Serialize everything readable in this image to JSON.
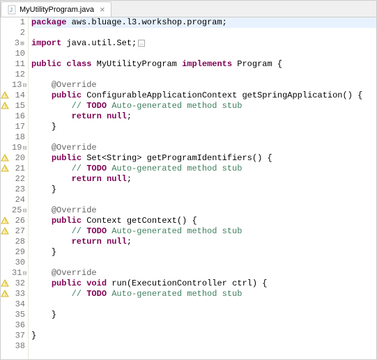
{
  "tab": {
    "filename": "MyUtilityProgram.java",
    "close": "×"
  },
  "lines": [
    {
      "num": "1",
      "marker": "",
      "fold": "",
      "highlighted": true,
      "segs": [
        {
          "t": "kw",
          "v": "package"
        },
        {
          "t": "",
          "v": " aws.bluage.l3.workshop.program;"
        }
      ],
      "cursor": true
    },
    {
      "num": "2",
      "marker": "",
      "fold": "",
      "segs": []
    },
    {
      "num": "3",
      "marker": "",
      "fold": "⊕",
      "segs": [
        {
          "t": "kw",
          "v": "import"
        },
        {
          "t": "",
          "v": " java.util.Set;"
        }
      ],
      "collapsed": true
    },
    {
      "num": "10",
      "marker": "",
      "fold": "",
      "segs": []
    },
    {
      "num": "11",
      "marker": "",
      "fold": "",
      "segs": [
        {
          "t": "kw",
          "v": "public"
        },
        {
          "t": "",
          "v": " "
        },
        {
          "t": "kw",
          "v": "class"
        },
        {
          "t": "",
          "v": " MyUtilityProgram "
        },
        {
          "t": "kw",
          "v": "implements"
        },
        {
          "t": "",
          "v": " Program {"
        }
      ]
    },
    {
      "num": "12",
      "marker": "",
      "fold": "",
      "segs": []
    },
    {
      "num": "13",
      "marker": "",
      "fold": "⊖",
      "segs": [
        {
          "t": "",
          "v": "    "
        },
        {
          "t": "ann",
          "v": "@Override"
        }
      ]
    },
    {
      "num": "14",
      "marker": "warn",
      "fold": "",
      "segs": [
        {
          "t": "",
          "v": "    "
        },
        {
          "t": "kw",
          "v": "public"
        },
        {
          "t": "",
          "v": " ConfigurableApplicationContext getSpringApplication() {"
        }
      ]
    },
    {
      "num": "15",
      "marker": "warn",
      "fold": "",
      "segs": [
        {
          "t": "",
          "v": "        "
        },
        {
          "t": "comment",
          "v": "// "
        },
        {
          "t": "kw",
          "v": "TODO"
        },
        {
          "t": "comment",
          "v": " Auto-generated method stub"
        }
      ]
    },
    {
      "num": "16",
      "marker": "",
      "fold": "",
      "segs": [
        {
          "t": "",
          "v": "        "
        },
        {
          "t": "kw",
          "v": "return"
        },
        {
          "t": "",
          "v": " "
        },
        {
          "t": "kw",
          "v": "null"
        },
        {
          "t": "",
          "v": ";"
        }
      ]
    },
    {
      "num": "17",
      "marker": "",
      "fold": "",
      "segs": [
        {
          "t": "",
          "v": "    }"
        }
      ]
    },
    {
      "num": "18",
      "marker": "",
      "fold": "",
      "segs": []
    },
    {
      "num": "19",
      "marker": "",
      "fold": "⊖",
      "segs": [
        {
          "t": "",
          "v": "    "
        },
        {
          "t": "ann",
          "v": "@Override"
        }
      ]
    },
    {
      "num": "20",
      "marker": "warn",
      "fold": "",
      "segs": [
        {
          "t": "",
          "v": "    "
        },
        {
          "t": "kw",
          "v": "public"
        },
        {
          "t": "",
          "v": " Set<String> getProgramIdentifiers() {"
        }
      ]
    },
    {
      "num": "21",
      "marker": "warn",
      "fold": "",
      "segs": [
        {
          "t": "",
          "v": "        "
        },
        {
          "t": "comment",
          "v": "// "
        },
        {
          "t": "kw",
          "v": "TODO"
        },
        {
          "t": "comment",
          "v": " Auto-generated method stub"
        }
      ]
    },
    {
      "num": "22",
      "marker": "",
      "fold": "",
      "segs": [
        {
          "t": "",
          "v": "        "
        },
        {
          "t": "kw",
          "v": "return"
        },
        {
          "t": "",
          "v": " "
        },
        {
          "t": "kw",
          "v": "null"
        },
        {
          "t": "",
          "v": ";"
        }
      ]
    },
    {
      "num": "23",
      "marker": "",
      "fold": "",
      "segs": [
        {
          "t": "",
          "v": "    }"
        }
      ]
    },
    {
      "num": "24",
      "marker": "",
      "fold": "",
      "segs": []
    },
    {
      "num": "25",
      "marker": "",
      "fold": "⊖",
      "segs": [
        {
          "t": "",
          "v": "    "
        },
        {
          "t": "ann",
          "v": "@Override"
        }
      ]
    },
    {
      "num": "26",
      "marker": "warn",
      "fold": "",
      "segs": [
        {
          "t": "",
          "v": "    "
        },
        {
          "t": "kw",
          "v": "public"
        },
        {
          "t": "",
          "v": " Context getContext() {"
        }
      ]
    },
    {
      "num": "27",
      "marker": "warn",
      "fold": "",
      "segs": [
        {
          "t": "",
          "v": "        "
        },
        {
          "t": "comment",
          "v": "// "
        },
        {
          "t": "kw",
          "v": "TODO"
        },
        {
          "t": "comment",
          "v": " Auto-generated method stub"
        }
      ]
    },
    {
      "num": "28",
      "marker": "",
      "fold": "",
      "segs": [
        {
          "t": "",
          "v": "        "
        },
        {
          "t": "kw",
          "v": "return"
        },
        {
          "t": "",
          "v": " "
        },
        {
          "t": "kw",
          "v": "null"
        },
        {
          "t": "",
          "v": ";"
        }
      ]
    },
    {
      "num": "29",
      "marker": "",
      "fold": "",
      "segs": [
        {
          "t": "",
          "v": "    }"
        }
      ]
    },
    {
      "num": "30",
      "marker": "",
      "fold": "",
      "segs": []
    },
    {
      "num": "31",
      "marker": "",
      "fold": "⊖",
      "segs": [
        {
          "t": "",
          "v": "    "
        },
        {
          "t": "ann",
          "v": "@Override"
        }
      ]
    },
    {
      "num": "32",
      "marker": "warn",
      "fold": "",
      "segs": [
        {
          "t": "",
          "v": "    "
        },
        {
          "t": "kw",
          "v": "public"
        },
        {
          "t": "",
          "v": " "
        },
        {
          "t": "kw",
          "v": "void"
        },
        {
          "t": "",
          "v": " run(ExecutionController ctrl) {"
        }
      ]
    },
    {
      "num": "33",
      "marker": "warn",
      "fold": "",
      "segs": [
        {
          "t": "",
          "v": "        "
        },
        {
          "t": "comment",
          "v": "// "
        },
        {
          "t": "kw",
          "v": "TODO"
        },
        {
          "t": "comment",
          "v": " Auto-generated method stub"
        }
      ]
    },
    {
      "num": "34",
      "marker": "",
      "fold": "",
      "segs": []
    },
    {
      "num": "35",
      "marker": "",
      "fold": "",
      "segs": [
        {
          "t": "",
          "v": "    }"
        }
      ]
    },
    {
      "num": "36",
      "marker": "",
      "fold": "",
      "segs": []
    },
    {
      "num": "37",
      "marker": "",
      "fold": "",
      "segs": [
        {
          "t": "",
          "v": "}"
        }
      ]
    },
    {
      "num": "38",
      "marker": "",
      "fold": "",
      "segs": []
    }
  ]
}
